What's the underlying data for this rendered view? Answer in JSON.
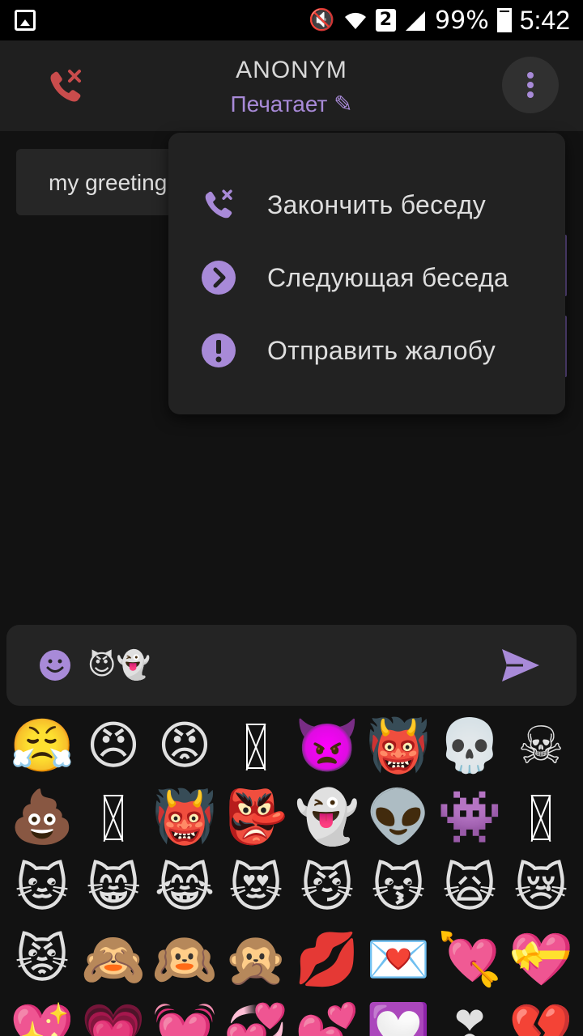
{
  "status_bar": {
    "sim_badge": "2",
    "battery": "99%",
    "time": "5:42"
  },
  "header": {
    "title": "ANONYM",
    "status": "Печатает ✎"
  },
  "chat": {
    "messages": [
      {
        "text": "my greeting"
      }
    ]
  },
  "menu": {
    "items": [
      {
        "label": "Закончить беседу",
        "icon": "end-call-icon"
      },
      {
        "label": "Следующая беседа",
        "icon": "next-chevron-icon"
      },
      {
        "label": "Отправить жалобу",
        "icon": "alert-icon"
      }
    ]
  },
  "input": {
    "value": "😈👻"
  },
  "colors": {
    "accent": "#a88ad8",
    "end_call": "#c94c4c"
  },
  "emoji_rows": [
    [
      "😤",
      "😠",
      "😡",
      "",
      "👿",
      "👹",
      "💀",
      "☠"
    ],
    [
      "💩",
      "",
      "👹",
      "👺",
      "👻",
      "👽",
      "👾",
      ""
    ],
    [
      "🐱",
      "😸",
      "😹",
      "😻",
      "😼",
      "😽",
      "🙀",
      "😿"
    ],
    [
      "😾",
      "🙈",
      "🙉",
      "🙊",
      "💋",
      "💌",
      "💘",
      "💝"
    ],
    [
      "💖",
      "💗",
      "💓",
      "💞",
      "💕",
      "💟",
      "❣",
      "💔"
    ]
  ]
}
